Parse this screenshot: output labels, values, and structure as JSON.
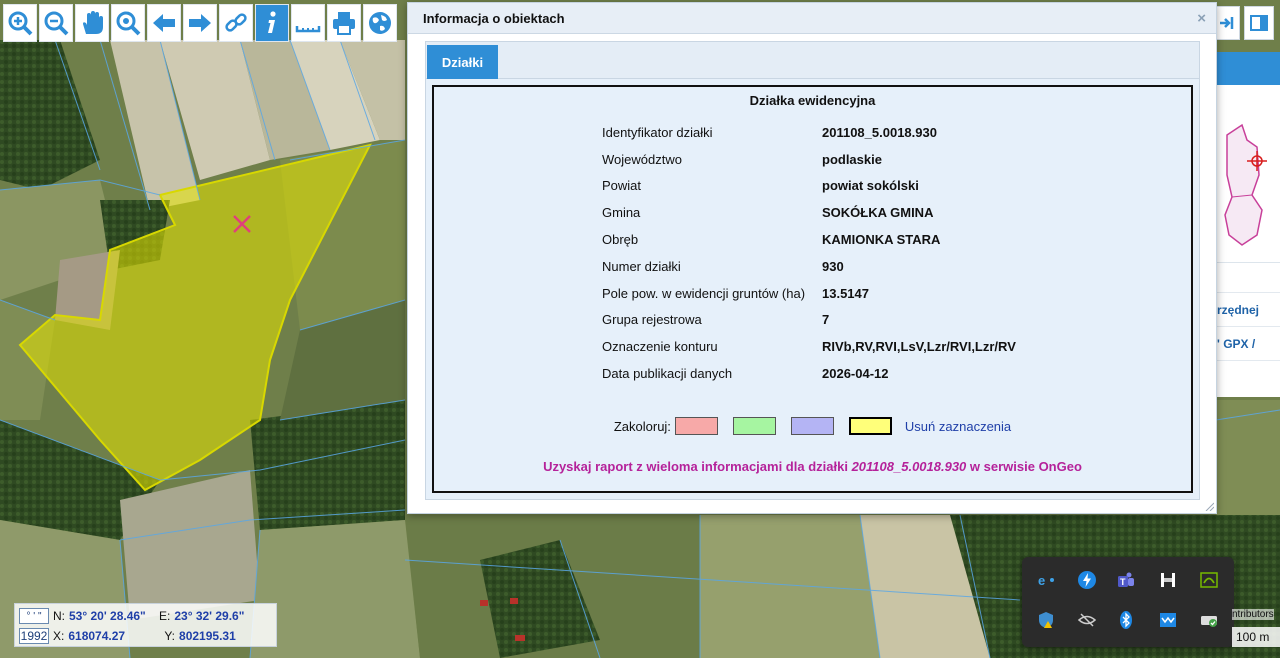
{
  "dialog": {
    "title": "Informacja o obiektach",
    "close_glyph": "×",
    "tab_label": "Działki"
  },
  "parcel": {
    "heading": "Działka ewidencyjna",
    "rows": [
      {
        "label": "Identyfikator działki",
        "value": "201108_5.0018.930"
      },
      {
        "label": "Województwo",
        "value": "podlaskie"
      },
      {
        "label": "Powiat",
        "value": "powiat sokólski"
      },
      {
        "label": "Gmina",
        "value": "SOKÓŁKA GMINA"
      },
      {
        "label": "Obręb",
        "value": "KAMIONKA STARA"
      },
      {
        "label": "Numer działki",
        "value": "930"
      },
      {
        "label": "Pole pow. w ewidencji gruntów (ha)",
        "value": "13.5147"
      },
      {
        "label": "Grupa rejestrowa",
        "value": "7"
      },
      {
        "label": "Oznaczenie konturu",
        "value": "RIVb,RV,RVI,LsV,Lzr/RVI,Lzr/RV"
      },
      {
        "label": "Data publikacji danych",
        "value": "2026-04-12"
      }
    ],
    "colour_label": "Zakoloruj:",
    "swatch_colors": [
      "#f7a9a8",
      "#a6f5a1",
      "#b4b4f4",
      "#ffff7a"
    ],
    "clear_label": "Usuń zaznaczenia",
    "report_prefix": "Uzyskaj raport z wieloma informacjami dla działki",
    "report_id": "201108_5.0018.930",
    "report_suffix": "w serwisie OnGeo"
  },
  "coords": {
    "format_btn": "° ' \"",
    "epsg_btn": "1992",
    "n_label": "N:",
    "n_value": "53° 20' 28.46\"",
    "e_label": "E:",
    "e_value": "23° 32' 29.6\"",
    "x_label": "X:",
    "x_value": "618074.27",
    "y_label": "Y:",
    "y_value": "802195.31"
  },
  "side_panel": {
    "row1": "rzędnej",
    "row2": "' GPX /"
  },
  "map": {
    "scale_label": "100 m",
    "attribution": "ntributors"
  },
  "toolbar": {
    "buttons": [
      "zoom-in-icon",
      "zoom-out-icon",
      "pan-hand-icon",
      "zoom-extent-icon",
      "back-arrow-icon",
      "forward-arrow-icon",
      "link-icon",
      "info-icon",
      "measure-icon",
      "print-icon",
      "globe-icon"
    ],
    "active_index": 7
  },
  "colors": {
    "accent": "#2f8ed6",
    "parcel_fill": "#e6e600",
    "parcel_marker": "#e0407a",
    "report_text": "#b5229a"
  }
}
